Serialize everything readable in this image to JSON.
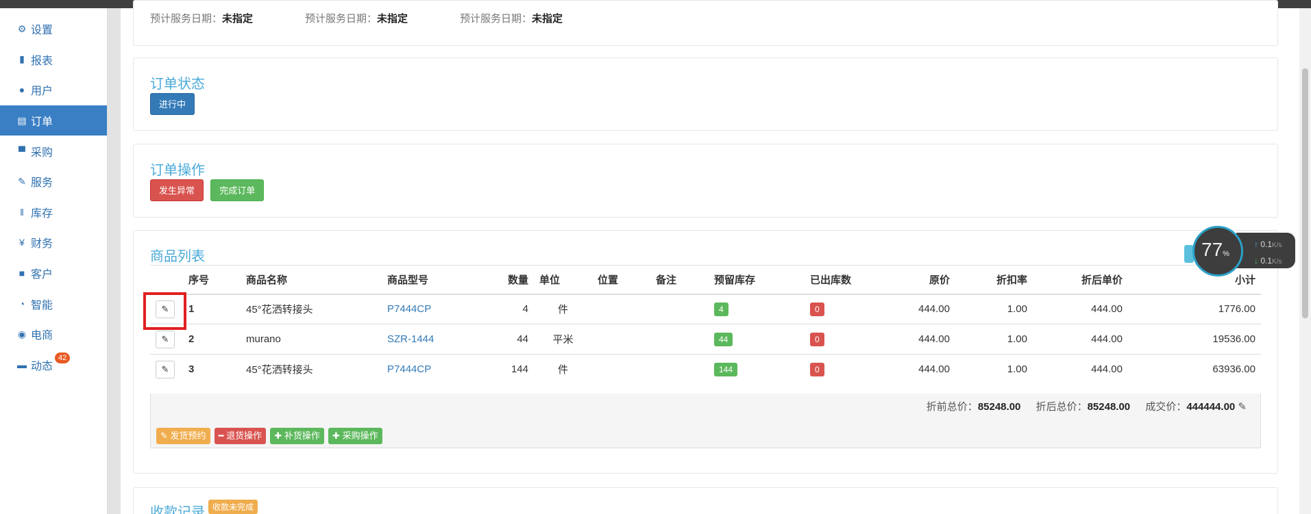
{
  "sidebar": {
    "items": [
      {
        "label": "设置",
        "icon": "gear-icon"
      },
      {
        "label": "报表",
        "icon": "bar-chart-icon"
      },
      {
        "label": "用户",
        "icon": "user-icon"
      },
      {
        "label": "订单",
        "icon": "list-icon"
      },
      {
        "label": "采购",
        "icon": "cart-icon"
      },
      {
        "label": "服务",
        "icon": "wrench-icon"
      },
      {
        "label": "库存",
        "icon": "barcode-icon"
      },
      {
        "label": "财务",
        "icon": "yen-icon"
      },
      {
        "label": "客户",
        "icon": "briefcase-icon"
      },
      {
        "label": "智能",
        "icon": "dashboard-icon"
      },
      {
        "label": "电商",
        "icon": "globe-icon"
      },
      {
        "label": "动态",
        "icon": "comment-icon",
        "badge": "42"
      }
    ],
    "active": "订单"
  },
  "service_dates": [
    {
      "label": "预计服务日期：",
      "value": "未指定"
    },
    {
      "label": "预计服务日期：",
      "value": "未指定"
    },
    {
      "label": "预计服务日期：",
      "value": "未指定"
    }
  ],
  "order_status": {
    "title": "订单状态",
    "button": "进行中"
  },
  "order_ops": {
    "title": "订单操作",
    "abnormal_button": "发生异常",
    "complete_button": "完成订单"
  },
  "products": {
    "title": "商品列表",
    "columns": [
      "序号",
      "商品名称",
      "商品型号",
      "数量",
      "单位",
      "位置",
      "备注",
      "预留库存",
      "已出库数",
      "原价",
      "折扣率",
      "折后单价",
      "小计"
    ],
    "rows": [
      {
        "no": "1",
        "name": "45°花洒转接头",
        "model": "P7444CP",
        "qty": "4",
        "unit": "件",
        "location": "",
        "note": "",
        "reserved": "4",
        "shipped": "0",
        "price": "444.00",
        "discount": "1.00",
        "unit_after": "444.00",
        "subtotal": "1776.00"
      },
      {
        "no": "2",
        "name": "murano",
        "model": "SZR-1444",
        "qty": "44",
        "unit": "平米",
        "location": "",
        "note": "",
        "reserved": "44",
        "shipped": "0",
        "price": "444.00",
        "discount": "1.00",
        "unit_after": "444.00",
        "subtotal": "19536.00"
      },
      {
        "no": "3",
        "name": "45°花洒转接头",
        "model": "P7444CP",
        "qty": "144",
        "unit": "件",
        "location": "",
        "note": "",
        "reserved": "144",
        "shipped": "0",
        "price": "444.00",
        "discount": "1.00",
        "unit_after": "444.00",
        "subtotal": "63936.00"
      }
    ],
    "totals": {
      "before_label": "折前总价：",
      "before": "85248.00",
      "after_label": "折后总价：",
      "after": "85248.00",
      "deal_label": "成交价：",
      "deal": "444444.00"
    },
    "actions": [
      "发货预约",
      "退货操作",
      "补货操作",
      "采购操作"
    ]
  },
  "payments": {
    "title": "收款记录",
    "badge": "收款未完成"
  },
  "net_widget": {
    "percent": "77",
    "percent_sign": "%",
    "up": "0.1",
    "down": "0.1",
    "unit": "K/s"
  }
}
